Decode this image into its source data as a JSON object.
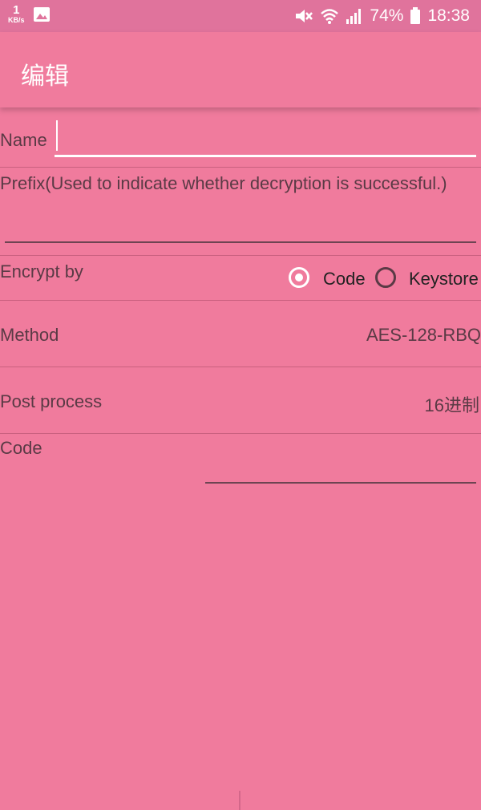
{
  "status_bar": {
    "net_speed_value": "1",
    "net_speed_unit": "KB/s",
    "battery_percent": "74%",
    "time": "18:38",
    "icons": [
      "image-icon",
      "mute-icon",
      "wifi-icon",
      "signal-icon",
      "battery-icon"
    ]
  },
  "app_bar": {
    "title": "编辑"
  },
  "form": {
    "name_label": "Name",
    "name_value": "",
    "prefix_label": "Prefix(Used to indicate whether decryption is successful.)",
    "prefix_value": "",
    "encrypt_label": "Encrypt by",
    "encrypt_options": [
      {
        "label": "Code",
        "selected": true
      },
      {
        "label": "Keystore",
        "selected": false
      }
    ],
    "method_label": "Method",
    "method_value": "AES-128-RBQ",
    "post_process_label": "Post process",
    "post_process_value": "16进制",
    "code_label": "Code",
    "code_value": ""
  },
  "colors": {
    "background": "#F07B9D",
    "status_bar": "#E0739C",
    "text": "#5A3A45"
  }
}
